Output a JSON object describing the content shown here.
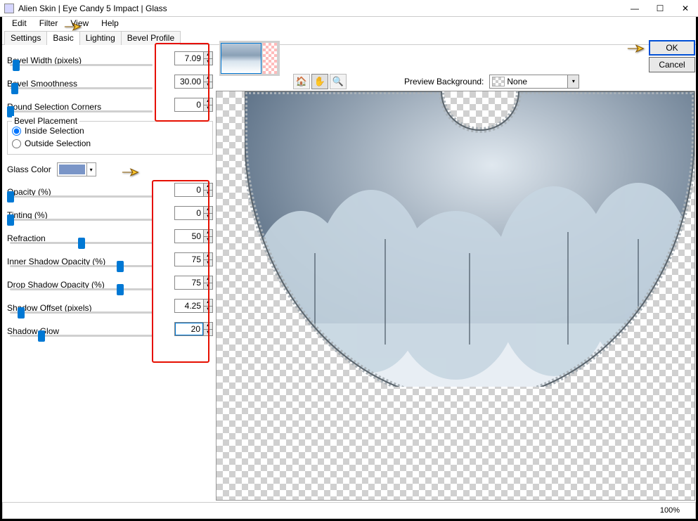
{
  "window": {
    "title": "Alien Skin | Eye Candy 5 Impact | Glass"
  },
  "menu": [
    "Edit",
    "Filter",
    "View",
    "Help"
  ],
  "tabs": [
    "Settings",
    "Basic",
    "Lighting",
    "Bevel Profile"
  ],
  "active_tab": 1,
  "params": {
    "bevel_width": {
      "label": "Bevel Width (pixels)",
      "value": "7.09",
      "thumb_pct": 4
    },
    "bevel_smooth": {
      "label": "Bevel Smoothness",
      "value": "30.00",
      "thumb_pct": 3
    },
    "round_corners": {
      "label": "Round Selection Corners",
      "value": "0",
      "thumb_pct": 0
    },
    "opacity": {
      "label": "Opacity (%)",
      "value": "0",
      "thumb_pct": 0
    },
    "tinting": {
      "label": "Tinting (%)",
      "value": "0",
      "thumb_pct": 0
    },
    "refraction": {
      "label": "Refraction",
      "value": "50",
      "thumb_pct": 48
    },
    "inner_shadow": {
      "label": "Inner Shadow Opacity (%)",
      "value": "75",
      "thumb_pct": 74
    },
    "drop_shadow": {
      "label": "Drop Shadow Opacity (%)",
      "value": "75",
      "thumb_pct": 74
    },
    "shadow_offset": {
      "label": "Shadow Offset (pixels)",
      "value": "4.25",
      "thumb_pct": 7
    },
    "shadow_glow": {
      "label": "Shadow Glow",
      "value": "20",
      "thumb_pct": 21
    }
  },
  "bevel_placement": {
    "legend": "Bevel Placement",
    "inside": "Inside Selection",
    "outside": "Outside Selection"
  },
  "glass_color": {
    "label": "Glass Color",
    "swatch": "#7a95c7"
  },
  "preview": {
    "bg_label": "Preview Background:",
    "bg_value": "None"
  },
  "buttons": {
    "ok": "OK",
    "cancel": "Cancel"
  },
  "status": {
    "zoom": "100%"
  },
  "icons": {
    "min": "—",
    "max": "☐",
    "close": "✕",
    "drop": "▾",
    "up": "▲",
    "down": "▼"
  }
}
